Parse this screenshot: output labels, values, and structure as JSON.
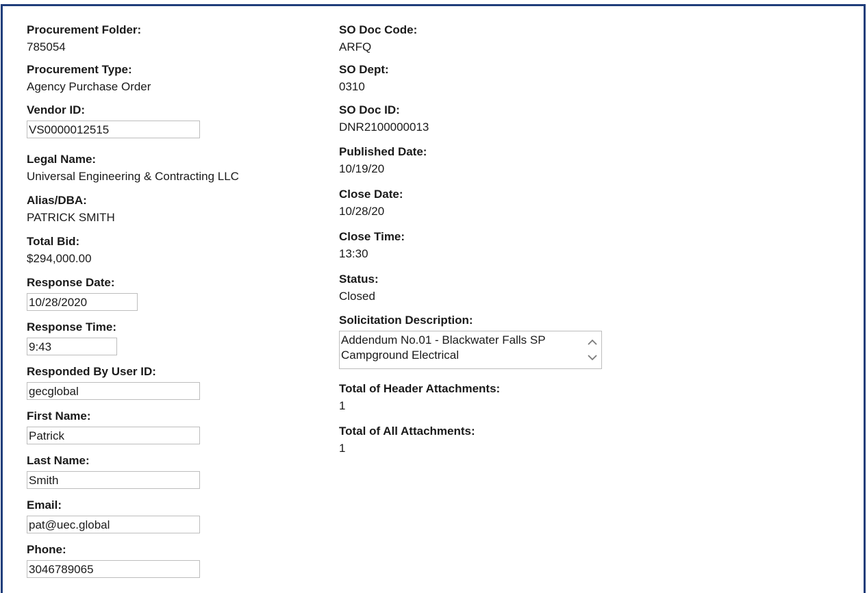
{
  "left": {
    "procurement_folder_label": "Procurement Folder:",
    "procurement_folder_value": "785054",
    "procurement_type_label": "Procurement Type:",
    "procurement_type_value": "Agency Purchase Order",
    "vendor_id_label": "Vendor ID:",
    "vendor_id_value": "VS0000012515",
    "legal_name_label": "Legal Name:",
    "legal_name_value": "Universal Engineering & Contracting LLC",
    "alias_label": "Alias/DBA:",
    "alias_value": "PATRICK SMITH",
    "total_bid_label": "Total Bid:",
    "total_bid_value": "$294,000.00",
    "response_date_label": "Response Date:",
    "response_date_value": "10/28/2020",
    "response_time_label": "Response Time:",
    "response_time_value": "9:43",
    "responded_by_label": "Responded By User ID:",
    "responded_by_value": "gecglobal",
    "first_name_label": "First Name:",
    "first_name_value": "Patrick",
    "last_name_label": "Last Name:",
    "last_name_value": "Smith",
    "email_label": "Email:",
    "email_value": "pat@uec.global",
    "phone_label": "Phone:",
    "phone_value": "3046789065"
  },
  "right": {
    "so_doc_code_label": "SO Doc Code:",
    "so_doc_code_value": "ARFQ",
    "so_dept_label": "SO Dept:",
    "so_dept_value": "0310",
    "so_doc_id_label": "SO Doc ID:",
    "so_doc_id_value": "DNR2100000013",
    "published_date_label": "Published Date:",
    "published_date_value": "10/19/20",
    "close_date_label": "Close Date:",
    "close_date_value": "10/28/20",
    "close_time_label": "Close Time:",
    "close_time_value": "13:30",
    "status_label": "Status:",
    "status_value": "Closed",
    "solicitation_description_label": "Solicitation Description:",
    "solicitation_description_value": "Addendum No.01 - Blackwater Falls SP Campground Electrical",
    "total_header_attachments_label": "Total of Header Attachments:",
    "total_header_attachments_value": "1",
    "total_all_attachments_label": "Total of All Attachments:",
    "total_all_attachments_value": "1"
  },
  "colors": {
    "frame_border": "#1f3d7a",
    "input_border": "#bdbdbd",
    "text": "#1a1a1a"
  },
  "icons": {
    "scroll_up": "chevron-up-icon",
    "scroll_down": "chevron-down-icon"
  }
}
